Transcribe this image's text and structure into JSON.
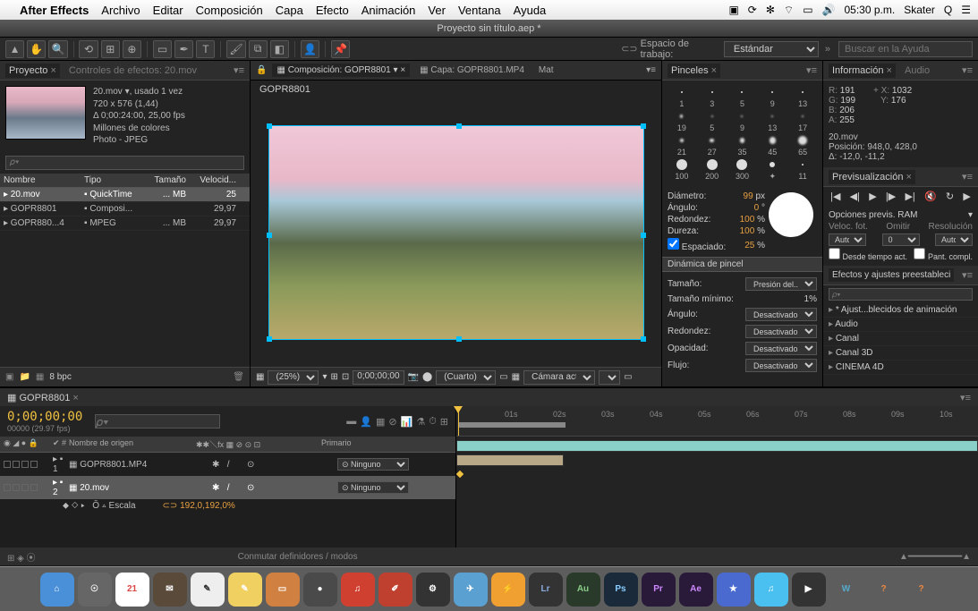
{
  "menubar": {
    "app": "After Effects",
    "items": [
      "Archivo",
      "Editar",
      "Composición",
      "Capa",
      "Efecto",
      "Animación",
      "Ver",
      "Ventana",
      "Ayuda"
    ],
    "time": "05:30 p.m.",
    "user": "Skater"
  },
  "title": "Proyecto sin título.aep *",
  "workspace": {
    "label": "Espacio de trabajo:",
    "value": "Estándar",
    "search_placeholder": "Buscar en la Ayuda"
  },
  "project": {
    "tab": "Proyecto",
    "tab2": "Controles de efectos: 20.mov",
    "selected": "20.mov ▾, usado 1 vez",
    "dims": "720 x 576 (1,44)",
    "dur": "Δ 0;00:24:00, 25,00 fps",
    "colors": "Millones de colores",
    "codec": "Photo - JPEG",
    "cols": [
      "Nombre",
      "Tipo",
      "Tamaño",
      "Velocid..."
    ],
    "rows": [
      {
        "name": "20.mov",
        "type": "QuickTime",
        "size": "... MB",
        "fps": "25",
        "sel": true
      },
      {
        "name": "GOPR8801",
        "type": "Composi...",
        "size": "",
        "fps": "29,97"
      },
      {
        "name": "GOPR880...4",
        "type": "MPEG",
        "size": "... MB",
        "fps": "29,97"
      }
    ],
    "bpc": "8 bpc"
  },
  "comp": {
    "tab_label": "Composición: GOPR8801",
    "tab2": "Capa: GOPR8801.MP4",
    "tab3": "Mat",
    "name": "GOPR8801",
    "zoom": "(25%)",
    "tc": "0;00;00;00",
    "res": "(Cuarto)",
    "cam": "Cámara activa",
    "view": "1"
  },
  "brushes": {
    "tab": "Pinceles",
    "sizes": [
      1,
      3,
      5,
      9,
      13,
      19,
      5,
      9,
      13,
      17,
      21,
      27,
      35,
      45,
      65,
      100,
      200,
      300,
      "✦",
      11
    ],
    "diam_label": "Diámetro:",
    "diam": "99",
    "diam_unit": "px",
    "ang_label": "Ángulo:",
    "ang": "0",
    "ang_unit": "°",
    "round_label": "Redondez:",
    "round": "100",
    "pct": "%",
    "hard_label": "Dureza:",
    "hard": "100",
    "space_label": "Espaciado:",
    "space": "25",
    "dyn_title": "Dinámica de pincel",
    "dyn": [
      {
        "l": "Tamaño:",
        "v": "Presión del..."
      },
      {
        "l": "Tamaño mínimo:",
        "v": "1%"
      },
      {
        "l": "Ángulo:",
        "v": "Desactivado"
      },
      {
        "l": "Redondez:",
        "v": "Desactivado"
      },
      {
        "l": "Opacidad:",
        "v": "Desactivado"
      },
      {
        "l": "Flujo:",
        "v": "Desactivado"
      }
    ]
  },
  "info": {
    "tab": "Información",
    "tab2": "Audio",
    "r": "191",
    "g": "199",
    "b": "206",
    "a": "255",
    "x": "1032",
    "y": "176",
    "name": "20.mov",
    "pos": "Posición: 948,0, 428,0",
    "delta": "Δ: -12,0, -11,2"
  },
  "preview": {
    "tab": "Previsualización",
    "opts_label": "Opciones previs. RAM",
    "h1": "Veloc. fot.",
    "h2": "Omitir",
    "h3": "Resolución",
    "v1": "Autom.",
    "v2": "0",
    "v3": "Autom.",
    "cb1": "Desde tiempo act.",
    "cb2": "Pant. compl."
  },
  "effects": {
    "tab": "Efectos y ajustes preestableci",
    "items": [
      "* Ajust...blecidos de animación",
      "Audio",
      "Canal",
      "Canal 3D",
      "CINEMA 4D"
    ]
  },
  "timeline": {
    "tab": "GOPR8801",
    "tc": "0;00;00;00",
    "fps": "00000 (29.97 fps)",
    "h_name": "Nombre de origen",
    "h_parent": "Primario",
    "layers": [
      {
        "n": "1",
        "name": "GOPR8801.MP4",
        "parent": "Ninguno"
      },
      {
        "n": "2",
        "name": "20.mov",
        "parent": "Ninguno",
        "sel": true
      }
    ],
    "prop": "Escala",
    "val": "192,0,192,0%",
    "ticks": [
      "",
      "01s",
      "02s",
      "03s",
      "04s",
      "05s",
      "06s",
      "07s",
      "08s",
      "09s",
      "10s"
    ],
    "toggle": "Conmutar definidores / modos"
  },
  "dock": {
    "items": [
      {
        "bg": "#4a90d9",
        "t": "⌂"
      },
      {
        "bg": "#666",
        "t": "☉"
      },
      {
        "bg": "#fff",
        "t": "21",
        "c": "#d44"
      },
      {
        "bg": "#5a4a3a",
        "t": "✉"
      },
      {
        "bg": "#eee",
        "t": "✎",
        "c": "#333"
      },
      {
        "bg": "#f0d060",
        "t": "✎"
      },
      {
        "bg": "#d08040",
        "t": "▭"
      },
      {
        "bg": "#4a4a4a",
        "t": "●"
      },
      {
        "bg": "#d04030",
        "t": "♫"
      },
      {
        "bg": "#c04030",
        "t": "✐"
      },
      {
        "bg": "#333",
        "t": "⚙"
      },
      {
        "bg": "#5aa0d0",
        "t": "✈"
      },
      {
        "bg": "#f0a030",
        "t": "⚡"
      },
      {
        "bg": "#333",
        "t": "Lr",
        "c": "#8ad"
      },
      {
        "bg": "#2a3a2a",
        "t": "Au",
        "c": "#8c8"
      },
      {
        "bg": "#1a2a3a",
        "t": "Ps",
        "c": "#8cf"
      },
      {
        "bg": "#2a1a3a",
        "t": "Pr",
        "c": "#c8f"
      },
      {
        "bg": "#2a1a3a",
        "t": "Ae",
        "c": "#c8f"
      },
      {
        "bg": "#4a6ad0",
        "t": "★"
      },
      {
        "bg": "#4ac0f0",
        "t": "♫"
      },
      {
        "bg": "#333",
        "t": "▶"
      },
      {
        "bg": "transparent",
        "t": "W",
        "c": "#5ac"
      },
      {
        "bg": "transparent",
        "t": "?",
        "c": "#e84"
      },
      {
        "bg": "transparent",
        "t": "?",
        "c": "#e84"
      }
    ]
  }
}
